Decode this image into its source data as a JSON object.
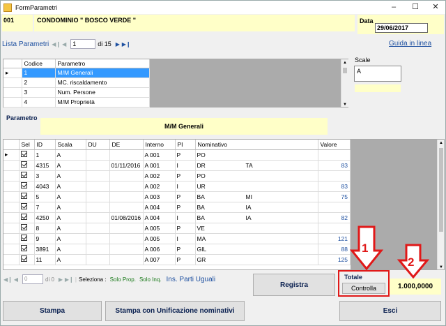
{
  "window": {
    "title": "FormParametri"
  },
  "header": {
    "code": "001",
    "name": "CONDOMINIO \" BOSCO VERDE \"",
    "data_label": "Data",
    "data_value": "29/06/2017"
  },
  "params_nav": {
    "label": "Lista Parametri",
    "position": "1",
    "count": "di 15"
  },
  "help_link": "Guida in linea",
  "scale": {
    "label": "Scale",
    "value": "A"
  },
  "params_grid": {
    "columns": [
      "Codice",
      "Parametro"
    ],
    "rows": [
      {
        "codice": "1",
        "parametro": "M/M Generali"
      },
      {
        "codice": "2",
        "parametro": "MC. riscaldamento"
      },
      {
        "codice": "3",
        "parametro": "Num. Persone"
      },
      {
        "codice": "4",
        "parametro": "M/M Proprietà"
      }
    ]
  },
  "parametro": {
    "label": "Parametro",
    "value": "M/M Generali"
  },
  "main_grid": {
    "columns": [
      "Sel",
      "ID",
      "Scala",
      "DU",
      "DE",
      "Interno",
      "PI",
      "Nominativo",
      "Valore"
    ],
    "rows": [
      {
        "id": "1",
        "scala": "A",
        "du": "",
        "de": "",
        "interno": "A 001",
        "pi": "P",
        "nominativo": "PO",
        "nom_tail": "",
        "valore": ""
      },
      {
        "id": "4315",
        "scala": "A",
        "du": "",
        "de": "01/11/2016",
        "interno": "A 001",
        "pi": "I",
        "nominativo": "DR",
        "nom_tail": "TA",
        "valore": "83"
      },
      {
        "id": "3",
        "scala": "A",
        "du": "",
        "de": "",
        "interno": "A 002",
        "pi": "P",
        "nominativo": "PO",
        "nom_tail": "",
        "valore": ""
      },
      {
        "id": "4043",
        "scala": "A",
        "du": "",
        "de": "",
        "interno": "A 002",
        "pi": "I",
        "nominativo": "UR",
        "nom_tail": "",
        "valore": "83"
      },
      {
        "id": "5",
        "scala": "A",
        "du": "",
        "de": "",
        "interno": "A 003",
        "pi": "P",
        "nominativo": "BA",
        "nom_tail": "MI",
        "valore": "75"
      },
      {
        "id": "7",
        "scala": "A",
        "du": "",
        "de": "",
        "interno": "A 004",
        "pi": "P",
        "nominativo": "BA",
        "nom_tail": "IA",
        "valore": ""
      },
      {
        "id": "4250",
        "scala": "A",
        "du": "",
        "de": "01/08/2016",
        "interno": "A 004",
        "pi": "I",
        "nominativo": "BA",
        "nom_tail": "IA",
        "valore": "82"
      },
      {
        "id": "8",
        "scala": "A",
        "du": "",
        "de": "",
        "interno": "A 005",
        "pi": "P",
        "nominativo": "VE",
        "nom_tail": "",
        "valore": ""
      },
      {
        "id": "9",
        "scala": "A",
        "du": "",
        "de": "",
        "interno": "A 005",
        "pi": "I",
        "nominativo": "MA",
        "nom_tail": "",
        "valore": "121"
      },
      {
        "id": "3891",
        "scala": "A",
        "du": "",
        "de": "",
        "interno": "A 006",
        "pi": "P",
        "nominativo": "GIL",
        "nom_tail": "",
        "valore": "88"
      },
      {
        "id": "11",
        "scala": "A",
        "du": "",
        "de": "",
        "interno": "A 007",
        "pi": "P",
        "nominativo": "GR",
        "nom_tail": "",
        "valore": "125"
      }
    ]
  },
  "bottom_nav": {
    "position": "0",
    "count": "di 0",
    "seleziona": "Seleziona :",
    "solo_prop": "Solo Prop.",
    "solo_inq": "Solo Inq.",
    "ins_parti": "Ins. Parti Uguali"
  },
  "buttons": {
    "registra": "Registra",
    "controlla": "Controlla",
    "stampa": "Stampa",
    "stampa_unif": "Stampa con Unificazione nominativi",
    "esci": "Esci"
  },
  "totale": {
    "label": "Totale",
    "value": "1.000,0000"
  },
  "annotations": {
    "one": "1",
    "two": "2",
    "color": "#e01818"
  }
}
